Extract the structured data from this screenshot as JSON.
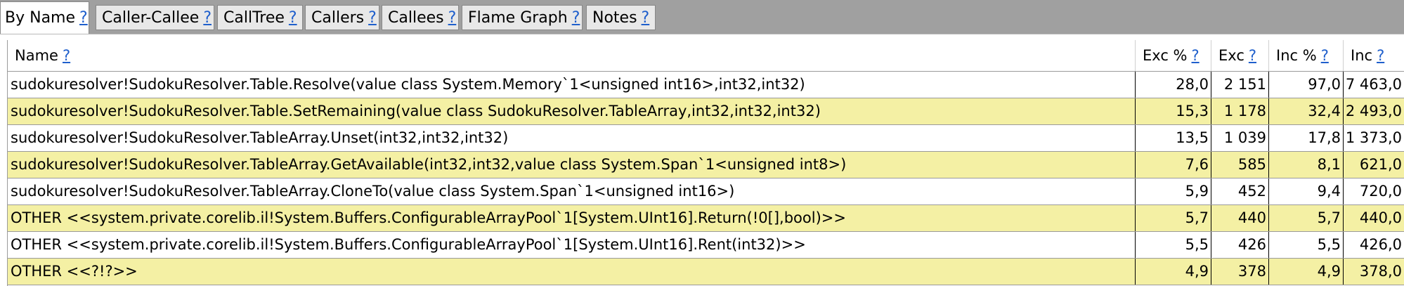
{
  "tabs": [
    {
      "label": "By Name",
      "help": "?",
      "active": true
    },
    {
      "label": "Caller-Callee",
      "help": "?"
    },
    {
      "label": "CallTree",
      "help": "?"
    },
    {
      "label": "Callers",
      "help": "?"
    },
    {
      "label": "Callees",
      "help": "?"
    },
    {
      "label": "Flame Graph",
      "help": "?"
    },
    {
      "label": "Notes",
      "help": "?"
    }
  ],
  "table": {
    "columns": [
      {
        "label": "Name",
        "help": "?"
      },
      {
        "label": "Exc %",
        "help": "?"
      },
      {
        "label": "Exc",
        "help": "?"
      },
      {
        "label": "Inc %",
        "help": "?"
      },
      {
        "label": "Inc",
        "help": "?"
      }
    ],
    "rows": [
      {
        "name": "sudokuresolver!SudokuResolver.Table.Resolve(value class System.Memory`1<unsigned int16>,int32,int32)",
        "exc_pct": "28,0",
        "exc": "2 151",
        "inc_pct": "97,0",
        "inc": "7 463,0"
      },
      {
        "name": "sudokuresolver!SudokuResolver.Table.SetRemaining(value class SudokuResolver.TableArray,int32,int32,int32)",
        "exc_pct": "15,3",
        "exc": "1 178",
        "inc_pct": "32,4",
        "inc": "2 493,0"
      },
      {
        "name": "sudokuresolver!SudokuResolver.TableArray.Unset(int32,int32,int32)",
        "exc_pct": "13,5",
        "exc": "1 039",
        "inc_pct": "17,8",
        "inc": "1 373,0"
      },
      {
        "name": "sudokuresolver!SudokuResolver.TableArray.GetAvailable(int32,int32,value class System.Span`1<unsigned int8>)",
        "exc_pct": "7,6",
        "exc": "585",
        "inc_pct": "8,1",
        "inc": "621,0"
      },
      {
        "name": "sudokuresolver!SudokuResolver.TableArray.CloneTo(value class System.Span`1<unsigned int16>)",
        "exc_pct": "5,9",
        "exc": "452",
        "inc_pct": "9,4",
        "inc": "720,0"
      },
      {
        "name": "OTHER <<system.private.corelib.il!System.Buffers.ConfigurableArrayPool`1[System.UInt16].Return(!0[],bool)>>",
        "exc_pct": "5,7",
        "exc": "440",
        "inc_pct": "5,7",
        "inc": "440,0"
      },
      {
        "name": "OTHER <<system.private.corelib.il!System.Buffers.ConfigurableArrayPool`1[System.UInt16].Rent(int32)>>",
        "exc_pct": "5,5",
        "exc": "426",
        "inc_pct": "5,5",
        "inc": "426,0"
      },
      {
        "name": "OTHER <<?!?>>",
        "exc_pct": "4,9",
        "exc": "378",
        "inc_pct": "4,9",
        "inc": "378,0"
      }
    ]
  },
  "colors": {
    "row_alt": "#f4f0a4",
    "help_link": "#1f5fcc",
    "tab_bar": "#a0a0a0"
  }
}
